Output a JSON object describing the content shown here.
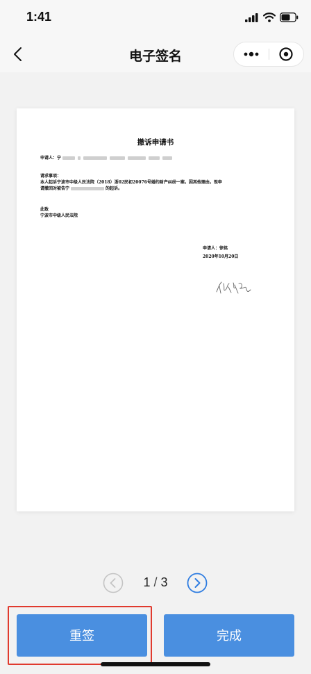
{
  "status_bar": {
    "time": "1:41"
  },
  "nav_bar": {
    "title": "电子签名"
  },
  "document": {
    "title": "撤诉申请书",
    "applicant_label": "申请人：宁",
    "request_heading": "请求事项：",
    "request_line1": "本人起诉宁波市中级人民法院（2018）浙02民初20076号婚约财产纠纷一案，因其他理由，现申",
    "request_line2_prefix": "请撤回对被告宁",
    "request_line2_suffix": "的起诉。",
    "closing": "此致",
    "court": "宁波市中级人民法院",
    "sign_applicant": "申请人：徐铭",
    "sign_date": "2020年10月20日",
    "signature_text": "徐铭"
  },
  "pager": {
    "current": "1",
    "separator": "/",
    "total": "3"
  },
  "buttons": {
    "resign_label": "重签",
    "done_label": "完成"
  },
  "colors": {
    "primary_button": "#4a8fe0",
    "highlight_border": "#e03a2e",
    "pager_icon": "#2f7de1"
  },
  "icons": [
    "signal-icon",
    "wifi-icon",
    "battery-icon",
    "back-chevron-icon",
    "more-icon",
    "close-target-icon",
    "prev-page-icon",
    "next-page-icon"
  ]
}
